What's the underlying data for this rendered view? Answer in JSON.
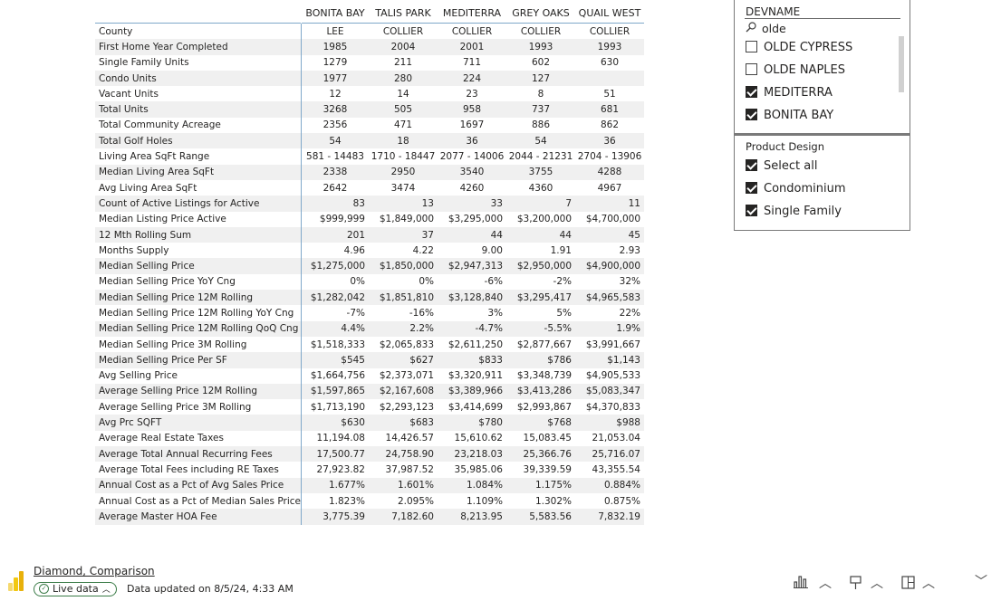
{
  "matrix": {
    "columns": [
      "BONITA BAY",
      "TALIS PARK",
      "MEDITERRA",
      "GREY OAKS",
      "QUAIL WEST"
    ],
    "rows": [
      {
        "label": "County",
        "values": [
          "LEE",
          "COLLIER",
          "COLLIER",
          "COLLIER",
          "COLLIER"
        ],
        "align": "center"
      },
      {
        "label": "First Home Year Completed",
        "values": [
          "1985",
          "2004",
          "2001",
          "1993",
          "1993"
        ],
        "align": "center"
      },
      {
        "label": "Single Family Units",
        "values": [
          "1279",
          "211",
          "711",
          "602",
          "630"
        ],
        "align": "center"
      },
      {
        "label": "Condo Units",
        "values": [
          "1977",
          "280",
          "224",
          "127",
          ""
        ],
        "align": "center"
      },
      {
        "label": "Vacant Units",
        "values": [
          "12",
          "14",
          "23",
          "8",
          "51"
        ],
        "align": "center"
      },
      {
        "label": "Total Units",
        "values": [
          "3268",
          "505",
          "958",
          "737",
          "681"
        ],
        "align": "center"
      },
      {
        "label": "Total Community Acreage",
        "values": [
          "2356",
          "471",
          "1697",
          "886",
          "862"
        ],
        "align": "center"
      },
      {
        "label": "Total Golf Holes",
        "values": [
          "54",
          "18",
          "36",
          "54",
          "36"
        ],
        "align": "center"
      },
      {
        "label": "Living Area SqFt Range",
        "values": [
          "581 - 14483",
          "1710 - 18447",
          "2077 - 14006",
          "2044 - 21231",
          "2704 - 13906"
        ],
        "align": "center"
      },
      {
        "label": "Median Living Area SqFt",
        "values": [
          "2338",
          "2950",
          "3540",
          "3755",
          "4288"
        ],
        "align": "center"
      },
      {
        "label": "Avg Living Area SqFt",
        "values": [
          "2642",
          "3474",
          "4260",
          "4360",
          "4967"
        ],
        "align": "center"
      },
      {
        "label": "Count of Active Listings for Active",
        "values": [
          "83",
          "13",
          "33",
          "7",
          "11"
        ],
        "align": "right"
      },
      {
        "label": "Median Listing Price Active",
        "values": [
          "$999,999",
          "$1,849,000",
          "$3,295,000",
          "$3,200,000",
          "$4,700,000"
        ],
        "align": "right"
      },
      {
        "label": "12 Mth Rolling Sum",
        "values": [
          "201",
          "37",
          "44",
          "44",
          "45"
        ],
        "align": "right"
      },
      {
        "label": "Months Supply",
        "values": [
          "4.96",
          "4.22",
          "9.00",
          "1.91",
          "2.93"
        ],
        "align": "right"
      },
      {
        "label": "Median Selling Price",
        "values": [
          "$1,275,000",
          "$1,850,000",
          "$2,947,313",
          "$2,950,000",
          "$4,900,000"
        ],
        "align": "right"
      },
      {
        "label": "Median Selling Price YoY Cng",
        "values": [
          "0%",
          "0%",
          "-6%",
          "-2%",
          "32%"
        ],
        "align": "right"
      },
      {
        "label": "Median Selling Price 12M Rolling",
        "values": [
          "$1,282,042",
          "$1,851,810",
          "$3,128,840",
          "$3,295,417",
          "$4,965,583"
        ],
        "align": "right"
      },
      {
        "label": "Median Selling Price 12M Rolling YoY Cng",
        "values": [
          "-7%",
          "-16%",
          "3%",
          "5%",
          "22%"
        ],
        "align": "right"
      },
      {
        "label": "Median Selling Price 12M Rolling QoQ Cng",
        "values": [
          "4.4%",
          "2.2%",
          "-4.7%",
          "-5.5%",
          "1.9%"
        ],
        "align": "right"
      },
      {
        "label": "Median Selling Price 3M Rolling",
        "values": [
          "$1,518,333",
          "$2,065,833",
          "$2,611,250",
          "$2,877,667",
          "$3,991,667"
        ],
        "align": "right"
      },
      {
        "label": "Median Selling Price Per SF",
        "values": [
          "$545",
          "$627",
          "$833",
          "$786",
          "$1,143"
        ],
        "align": "right"
      },
      {
        "label": "Avg Selling Price",
        "values": [
          "$1,664,756",
          "$2,373,071",
          "$3,320,911",
          "$3,348,739",
          "$4,905,533"
        ],
        "align": "right"
      },
      {
        "label": "Average Selling Price 12M Rolling",
        "values": [
          "$1,597,865",
          "$2,167,608",
          "$3,389,966",
          "$3,413,286",
          "$5,083,347"
        ],
        "align": "right"
      },
      {
        "label": "Average Selling Price 3M Rolling",
        "values": [
          "$1,713,190",
          "$2,293,123",
          "$3,414,699",
          "$2,993,867",
          "$4,370,833"
        ],
        "align": "right"
      },
      {
        "label": "Avg Prc SQFT",
        "values": [
          "$630",
          "$683",
          "$780",
          "$768",
          "$988"
        ],
        "align": "right"
      },
      {
        "label": "Average Real Estate Taxes",
        "values": [
          "11,194.08",
          "14,426.57",
          "15,610.62",
          "15,083.45",
          "21,053.04"
        ],
        "align": "right"
      },
      {
        "label": "Average Total Annual Recurring Fees",
        "values": [
          "17,500.77",
          "24,758.90",
          "23,218.03",
          "25,366.76",
          "25,716.07"
        ],
        "align": "right"
      },
      {
        "label": "Average Total Fees including RE Taxes",
        "values": [
          "27,923.82",
          "37,987.52",
          "35,985.06",
          "39,339.59",
          "43,355.54"
        ],
        "align": "right"
      },
      {
        "label": "Annual Cost as a Pct of Avg Sales Price",
        "values": [
          "1.677%",
          "1.601%",
          "1.084%",
          "1.175%",
          "0.884%"
        ],
        "align": "right"
      },
      {
        "label": "Annual Cost as a Pct of Median Sales Price",
        "values": [
          "1.823%",
          "2.095%",
          "1.109%",
          "1.302%",
          "0.875%"
        ],
        "align": "right"
      },
      {
        "label": "Average Master HOA Fee",
        "values": [
          "3,775.39",
          "7,182.60",
          "8,213.95",
          "5,583.56",
          "7,832.19"
        ],
        "align": "right"
      }
    ]
  },
  "devname_slicer": {
    "title": "DEVNAME",
    "search_icon": "search-icon",
    "search_value": "olde",
    "options": [
      {
        "label": "OLDE CYPRESS",
        "checked": false
      },
      {
        "label": "OLDE NAPLES",
        "checked": false
      },
      {
        "label": "MEDITERRA",
        "checked": true
      },
      {
        "label": "BONITA BAY",
        "checked": true
      }
    ]
  },
  "product_slicer": {
    "title": "Product Design",
    "options": [
      {
        "label": "Select all",
        "checked": true
      },
      {
        "label": "Condominium",
        "checked": true
      },
      {
        "label": "Single Family",
        "checked": true
      }
    ]
  },
  "footer": {
    "report_name": "Diamond, Comparison",
    "live_badge": "Live data",
    "updated_text": "Data updated on 8/5/24, 4:33 AM",
    "icons": [
      "report-app-icon",
      "visual-chart-icon",
      "feedback-icon",
      "edit-visuals-icon",
      "collapse-icon"
    ],
    "colors": {
      "accent_logo": "#f2c811",
      "live_green": "#3a7b47",
      "grid_line": "#7fa8c9"
    }
  }
}
